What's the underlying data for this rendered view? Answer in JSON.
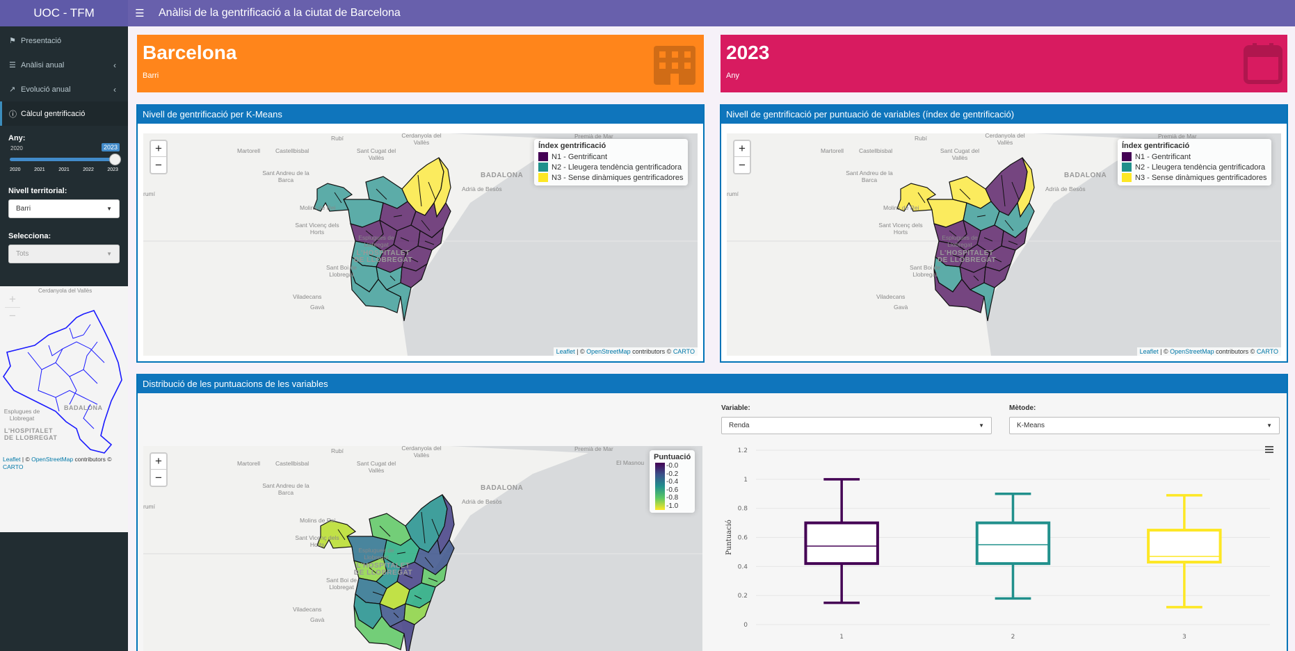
{
  "header": {
    "brand": "UOC - TFM",
    "title": "Anàlisi de la gentrificació a la ciutat de Barcelona"
  },
  "sidebar": {
    "menu": [
      {
        "label": "Presentació",
        "icon": "signpost-icon"
      },
      {
        "label": "Anàlisi anual",
        "icon": "layers-icon"
      },
      {
        "label": "Evolució anual",
        "icon": "line-chart-icon"
      },
      {
        "label": "Càlcul gentrificació",
        "icon": "info-circle-icon"
      }
    ],
    "year_label": "Any:",
    "year_min": "2020",
    "year_value": "2023",
    "year_ticks": [
      "2020",
      "2021",
      "2021",
      "2022",
      "2023"
    ],
    "level_label": "Nivell territorial:",
    "level_value": "Barri",
    "select_label": "Selecciona:",
    "select_value": "Tots",
    "mini_map": {
      "places": [
        "Cerdanyola del Vallès",
        "BADALONA",
        "Esplugues de Llobregat",
        "L'HOSPITALET DE LLOBREGAT"
      ],
      "attribution": {
        "leaflet": "Leaflet",
        "sep": " | © ",
        "osm": "OpenStreetMap",
        "rest": " contributors © ",
        "carto": "CARTO"
      }
    }
  },
  "value_boxes": [
    {
      "value": "Barcelona",
      "subtitle": "Barri",
      "color": "#ff851b",
      "icon": "building-icon"
    },
    {
      "value": "2023",
      "subtitle": "Any",
      "color": "#d81b60",
      "icon": "calendar-icon"
    }
  ],
  "map_places": [
    "Rubí",
    "Cerdanyola del Vallès",
    "Premià de Mar",
    "Martorell",
    "Castellbisbal",
    "Sant Cugat del Vallès",
    "Sant Andreu de la Barca",
    "BADALONA",
    "Adrià de Besòs",
    "Molins de Rei",
    "Sant Vicenç dels Horts",
    "Esplugues de Llobregat",
    "L'HOSPITALET DE LLOBREGAT",
    "Sant Boi de Llobregat",
    "Viladecans",
    "Gavà",
    "El Masnou",
    "rumí"
  ],
  "attribution": {
    "leaflet": "Leaflet",
    "sep": " | © ",
    "osm": "OpenStreetMap",
    "rest": " contributors © ",
    "carto": "CARTO"
  },
  "box_kmeans": {
    "title": "Nivell de gentrificació per K-Means",
    "legend_title": "Índex gentrificació",
    "legend": [
      {
        "label": "N1 - Gentrificant",
        "color": "#440154"
      },
      {
        "label": "N2 - Lleugera tendència gentrificadora",
        "color": "#21908c"
      },
      {
        "label": "N3 - Sense dinàmiques gentrificadores",
        "color": "#fde725"
      }
    ]
  },
  "box_index": {
    "title": "Nivell de gentrificació per puntuació de variables (índex de gentrificació)",
    "legend_title": "Índex gentrificació",
    "legend": [
      {
        "label": "N1 - Gentrificant",
        "color": "#440154"
      },
      {
        "label": "N2 - Lleugera tendència gentrificadora",
        "color": "#21908c"
      },
      {
        "label": "N3 - Sense dinàmiques gentrificadores",
        "color": "#fde725"
      }
    ]
  },
  "box_dist": {
    "title": "Distribució de les puntuacions de les variables",
    "legend_title": "Puntuació",
    "legend_ticks": [
      "0.0",
      "0.2",
      "0.4",
      "0.6",
      "0.8",
      "1.0"
    ],
    "variable_label": "Variable:",
    "variable_value": "Renda",
    "method_label": "Mètode:",
    "method_value": "K-Means"
  },
  "chart_data": {
    "type": "box",
    "categories": [
      "1",
      "2",
      "3"
    ],
    "ylabel": "Puntuació",
    "ylim": [
      0,
      1.2
    ],
    "yticks": [
      "0",
      "0.2",
      "0.4",
      "0.6",
      "0.8",
      "1",
      "1.2"
    ],
    "colors": [
      "#440154",
      "#21908c",
      "#fde725"
    ],
    "series": [
      {
        "min": 0.15,
        "q1": 0.42,
        "median": 0.54,
        "q3": 0.7,
        "max": 1.0
      },
      {
        "min": 0.18,
        "q1": 0.42,
        "median": 0.55,
        "q3": 0.7,
        "max": 0.9
      },
      {
        "min": 0.12,
        "q1": 0.43,
        "median": 0.47,
        "q3": 0.65,
        "max": 0.89
      }
    ]
  }
}
